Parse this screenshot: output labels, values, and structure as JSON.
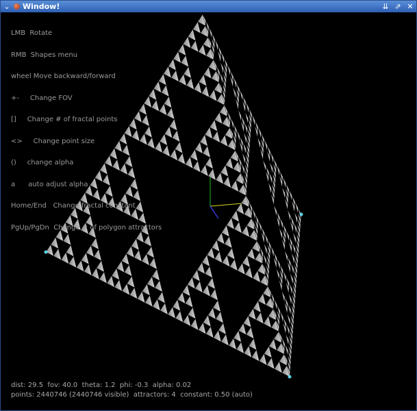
{
  "window": {
    "title": "Window!",
    "colors": {
      "titlebar": "#3d6fc2",
      "background": "#000000",
      "fractal": "#d8d8d8",
      "attractor": "#5fd3e6"
    }
  },
  "help": [
    "LMB  Rotate",
    "RMB  Shapes menu",
    "wheel Move backward/forward",
    "+-     Change FOV",
    "[]     Change # of fractal points",
    "<>     Change point size",
    "()     change alpha",
    "a      auto adjust alpha",
    "Home/End   Change fractal constant",
    "PgUp/PgDn  Change # of polygon attractors"
  ],
  "status": {
    "line1": "dist: 29.5  fov: 40.0  theta: 1.2  phi: -0.3  alpha: 0.02",
    "line2": "points: 2440746 (2440746 visible)  attractors: 4  constant: 0.50 (auto)"
  },
  "icons": [
    "minimize-icon",
    "maximize-icon",
    "close-icon",
    "window-menu-icon",
    "app-icon"
  ]
}
